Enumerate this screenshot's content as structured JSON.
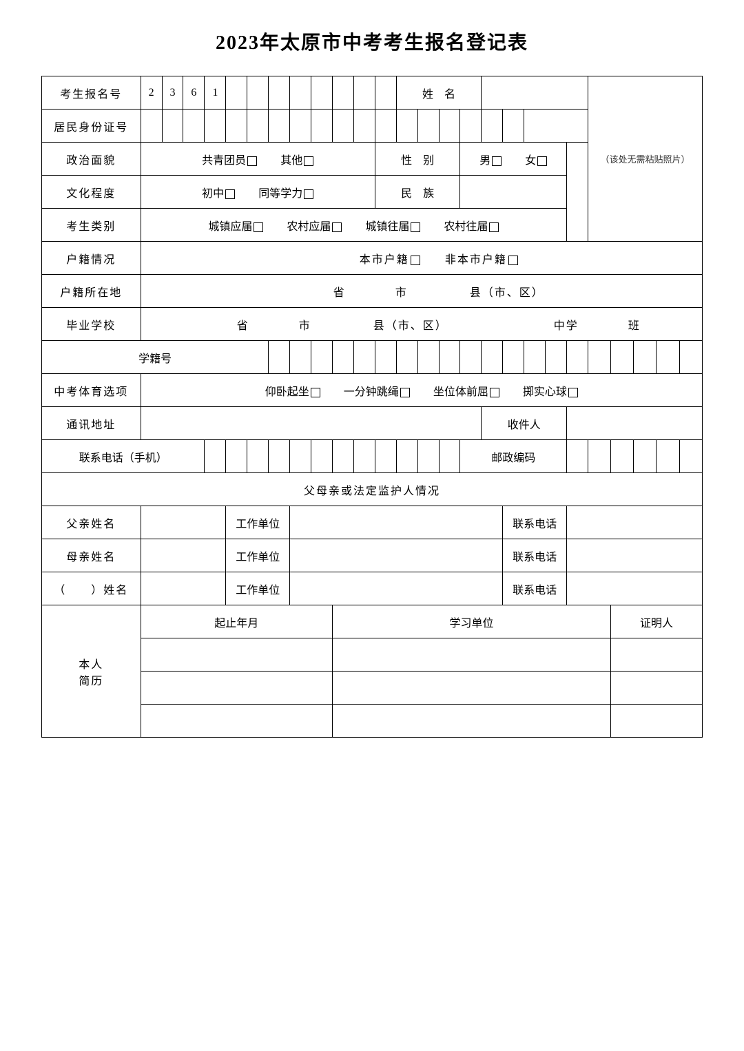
{
  "title": "2023年太原市中考考生报名登记表",
  "fields": {
    "candidate_number": "考生报名号",
    "candidate_number_digits": [
      "2",
      "3",
      "6",
      "1",
      "",
      "",
      "",
      "",
      "",
      "",
      "",
      ""
    ],
    "name": "姓　名",
    "id_number": "居民身份证号",
    "political": "政治面貌",
    "political_opt1": "共青团员",
    "political_opt2": "其他",
    "gender": "性　别",
    "gender_opt1": "男",
    "gender_opt2": "女",
    "photo_note": "（该处无需粘贴照片）",
    "education": "文化程度",
    "education_opt1": "初中",
    "education_opt2": "同等学力",
    "ethnicity": "民　族",
    "category": "考生类别",
    "category_opt1": "城镇应届",
    "category_opt2": "农村应届",
    "category_opt3": "城镇往届",
    "category_opt4": "农村往届",
    "household": "户籍情况",
    "household_opt1": "本市户籍",
    "household_opt2": "非本市户籍",
    "household_loc": "户籍所在地",
    "household_loc_text": "省　　　　市　　　　　县（市、区）",
    "grad_school": "毕业学校",
    "grad_school_text": "省　　　　市　　　　　县（市、区）　　　　　　　　　中学　　　　班",
    "student_id": "学籍号",
    "pe_option": "中考体育选项",
    "pe_opt1": "仰卧起坐",
    "pe_opt2": "一分钟跳绳",
    "pe_opt3": "坐位体前屈",
    "pe_opt4": "掷实心球",
    "address": "通讯地址",
    "recipient": "收件人",
    "phone": "联系电话（手机）",
    "postal": "邮政编码",
    "guardian_header": "父母亲或法定监护人情况",
    "father": "父亲姓名",
    "mother": "母亲姓名",
    "other_guardian": "（　　）姓名",
    "work_unit": "工作单位",
    "contact_phone": "联系电话",
    "resume": "本人\n简历",
    "resume_line1": "本人",
    "resume_line2": "简历",
    "period": "起止年月",
    "study_unit": "学习单位",
    "witness": "证明人"
  }
}
